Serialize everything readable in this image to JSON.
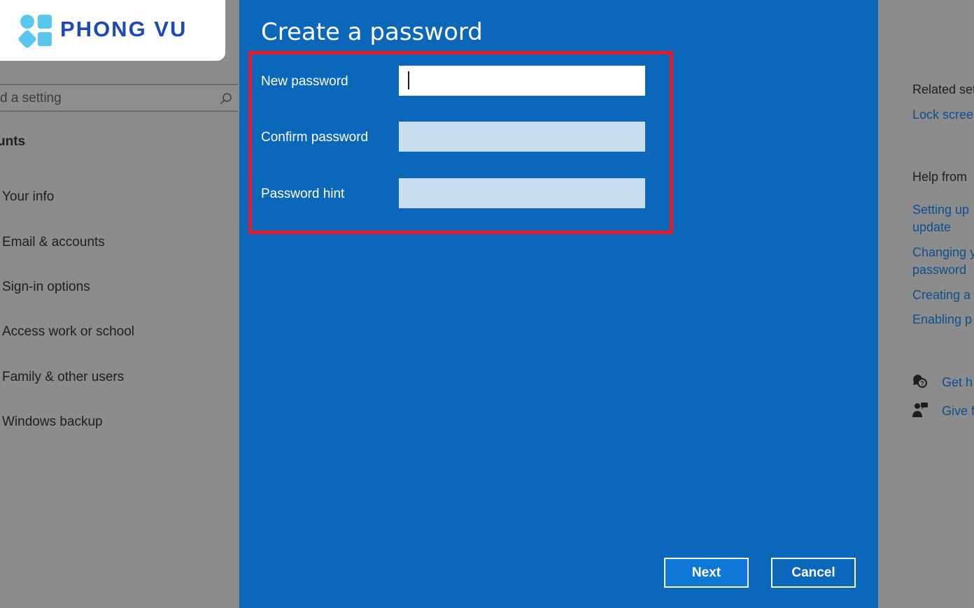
{
  "brand": {
    "name": "PHONG VU"
  },
  "settings": {
    "search": {
      "placeholder": "d a setting"
    },
    "section_title": "unts",
    "nav": [
      {
        "label": "Your info"
      },
      {
        "label": "Email & accounts"
      },
      {
        "label": "Sign-in options"
      },
      {
        "label": "Access work or school"
      },
      {
        "label": "Family & other users"
      },
      {
        "label": "Windows backup"
      }
    ]
  },
  "dialog": {
    "title": "Create a password",
    "fields": [
      {
        "label": "New password",
        "value": ""
      },
      {
        "label": "Confirm password",
        "value": ""
      },
      {
        "label": "Password hint",
        "value": ""
      }
    ],
    "buttons": {
      "next": "Next",
      "cancel": "Cancel"
    }
  },
  "related": {
    "related_heading": "Related set",
    "lock_link": "Lock screen",
    "help_heading": "Help from",
    "help_links": [
      {
        "line1": "Setting up",
        "line2": "update"
      },
      {
        "line1": "Changing y",
        "line2": "password"
      },
      {
        "line1": "Creating a",
        "line2": ""
      },
      {
        "line1": "Enabling p",
        "line2": ""
      }
    ],
    "get_help": "Get h",
    "give_feedback": "Give f"
  },
  "colors": {
    "dialog_bg": "#0a67b9",
    "highlight": "#e21b2a",
    "dimmed_bg": "#8c8c8c",
    "brand_blue": "#1c4bb5"
  }
}
